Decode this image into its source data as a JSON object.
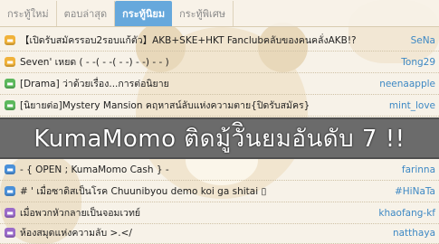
{
  "tabs": [
    {
      "label": "กระทู้ใหม่",
      "active": false
    },
    {
      "label": "ตอบล่าสุด",
      "active": false
    },
    {
      "label": "กระทู้นิยม",
      "active": true
    },
    {
      "label": "กระทู้พิเศษ",
      "active": false
    }
  ],
  "top_list": [
    {
      "icon": "yellow-chat-icon",
      "icon_color": "#f0b23a",
      "title": "【เปิดรับสมัครรอบ2รอบแก้ตัว】AKB+SKE+HKT Fanclubคลับของคนคลั่งAKB!?",
      "author": "SeNa"
    },
    {
      "icon": "yellow-chat-icon",
      "icon_color": "#f0b23a",
      "title": "Seven' เหยด ( - -( - -( - -) - -) - - )",
      "author": "Tong29"
    },
    {
      "icon": "green-chat-icon",
      "icon_color": "#5cb85c",
      "title": "[Drama] ว่าด้วยเรื่อง...การต่อนิยาย",
      "author": "neenaapple"
    },
    {
      "icon": "green-chat-icon",
      "icon_color": "#5cb85c",
      "title": "[นิยายต่อ]Mystery Mansion คฤหาสน์ลับแห่งความตาย{ปิดรับสมัคร}",
      "author": "mint_love"
    }
  ],
  "banner": {
    "text": "KumaMomo ติดมู้วัินยมอันดับ 7 !!"
  },
  "bottom_list": [
    {
      "icon": "blue-chat-icon",
      "icon_color": "#4a90d9",
      "title": "- { OPEN ; KumaMomo Cash } -",
      "author": "farinna"
    },
    {
      "icon": "blue-chat-icon",
      "icon_color": "#4a90d9",
      "title": "# ' เมื่อซาดิสเป็นโรค Chuunibyou demo koi ga shitai ▯",
      "author": "#HiNaTa"
    },
    {
      "icon": "purple-chat-icon",
      "icon_color": "#9b6bc9",
      "title": "เมื่อพวกหัวกลายเป็นจอมเวทย์",
      "author": "khaofang-kf"
    },
    {
      "icon": "purple-chat-icon",
      "icon_color": "#9b6bc9",
      "title": "ห้องสมุดแห่งความลับ >.</",
      "author": "natthaya"
    }
  ]
}
